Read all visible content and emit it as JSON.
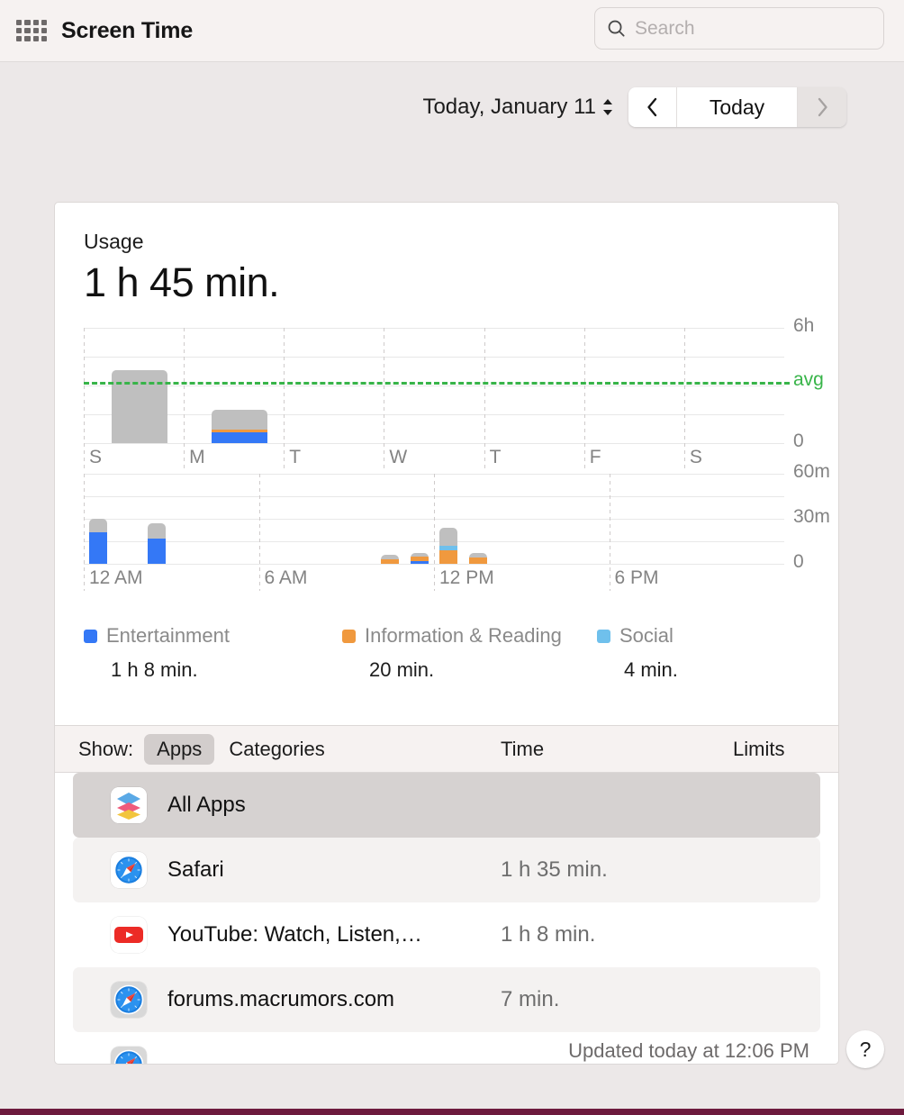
{
  "titlebar": {
    "grid_icon": "apps-grid-icon",
    "title": "Screen Time",
    "search_icon": "search-icon",
    "search_value": "",
    "search_placeholder": "Search"
  },
  "datebar": {
    "date_label": "Today, January 11",
    "stepper_icon": "up-down-stepper-icon",
    "prev_icon": "chevron-left-icon",
    "today_label": "Today",
    "next_icon": "chevron-right-icon"
  },
  "usage": {
    "label": "Usage",
    "total": "1 h 45 min."
  },
  "chart_data": [
    {
      "type": "bar",
      "name": "weekly-usage-chart",
      "title": "Usage",
      "orientation": "stacked-vertical",
      "categories": [
        "S",
        "M",
        "T",
        "W",
        "T",
        "F",
        "S"
      ],
      "xlabel": "",
      "ylabel": "",
      "ylim": [
        0,
        6
      ],
      "y_unit": "hours",
      "ticks": [
        "6h",
        "",
        "",
        "",
        "0"
      ],
      "tick_values": [
        6,
        4.5,
        3,
        1.5,
        0
      ],
      "grid": true,
      "annotations": [
        {
          "label": "avg",
          "value": 3.2,
          "color": "#38b449",
          "style": "dashed-line"
        }
      ],
      "series": [
        {
          "name": "Entertainment",
          "color": "#3478f6",
          "values": [
            0,
            0.58,
            0,
            0,
            0,
            0,
            0
          ]
        },
        {
          "name": "Information & Reading",
          "color": "#f0993e",
          "values": [
            0,
            0.14,
            0,
            0,
            0,
            0,
            0
          ]
        },
        {
          "name": "Social",
          "color": "#6fc0ec",
          "values": [
            0,
            0.0,
            0,
            0,
            0,
            0,
            0
          ]
        },
        {
          "name": "Other",
          "color": "#bfbfbf",
          "values": [
            3.8,
            1.03,
            0,
            0,
            0,
            0,
            0
          ]
        }
      ]
    },
    {
      "type": "bar",
      "name": "hourly-usage-chart",
      "orientation": "stacked-vertical",
      "categories": [
        "12 AM",
        "6 AM",
        "12 PM",
        "6 PM"
      ],
      "x": [
        "12 AM",
        "1 AM",
        "2 AM",
        "3 AM",
        "4 AM",
        "5 AM",
        "6 AM",
        "7 AM",
        "8 AM",
        "9 AM",
        "10 AM",
        "11 AM",
        "12 PM",
        "1 PM",
        "2 PM",
        "3 PM",
        "4 PM",
        "5 PM",
        "6 PM",
        "7 PM",
        "8 PM",
        "9 PM",
        "10 PM",
        "11 PM"
      ],
      "xlabel": "",
      "ylabel": "",
      "ylim": [
        0,
        60
      ],
      "y_unit": "minutes",
      "ticks": [
        "60m",
        "30m",
        "0"
      ],
      "tick_values": [
        60,
        30,
        0
      ],
      "grid": true,
      "series": [
        {
          "name": "Entertainment",
          "color": "#3478f6",
          "values": [
            21,
            0,
            17,
            0,
            0,
            0,
            0,
            0,
            0,
            0,
            0,
            2,
            0,
            0,
            0,
            0,
            0,
            0,
            0,
            0,
            0,
            0,
            0,
            0
          ]
        },
        {
          "name": "Information & Reading",
          "color": "#f0993e",
          "values": [
            0,
            0,
            0,
            0,
            0,
            0,
            0,
            0,
            0,
            0,
            3,
            3,
            9,
            4,
            0,
            0,
            0,
            0,
            0,
            0,
            0,
            0,
            0,
            0
          ]
        },
        {
          "name": "Social",
          "color": "#6fc0ec",
          "values": [
            0,
            0,
            0,
            0,
            0,
            0,
            0,
            0,
            0,
            0,
            0,
            0,
            3,
            0,
            0,
            0,
            0,
            0,
            0,
            0,
            0,
            0,
            0,
            0
          ]
        },
        {
          "name": "Other",
          "color": "#bfbfbf",
          "values": [
            9,
            0,
            10,
            0,
            0,
            0,
            0,
            0,
            0,
            0,
            3,
            2,
            12,
            3,
            0,
            0,
            0,
            0,
            0,
            0,
            0,
            0,
            0,
            0
          ]
        }
      ]
    }
  ],
  "legend": [
    {
      "name": "Entertainment",
      "color": "#3478f6",
      "time": "1 h 8 min."
    },
    {
      "name": "Information & Reading",
      "color": "#f0993e",
      "time": "20 min."
    },
    {
      "name": "Social",
      "color": "#6fc0ec",
      "time": "4 min."
    }
  ],
  "showbar": {
    "label": "Show:",
    "apps_tab": "Apps",
    "categories_tab": "Categories",
    "col_time": "Time",
    "col_limits": "Limits"
  },
  "apps": [
    {
      "name": "All Apps",
      "time": "",
      "icon": "all-apps-stack-icon"
    },
    {
      "name": "Safari",
      "time": "1 h 35 min.",
      "icon": "safari-compass-icon"
    },
    {
      "name": "YouTube: Watch, Listen,…",
      "time": "1 h 8 min.",
      "icon": "youtube-play-icon"
    },
    {
      "name": "forums.macrumors.com",
      "time": "7 min.",
      "icon": "safari-website-icon"
    },
    {
      "name": "",
      "time": "",
      "icon": "safari-website-icon"
    }
  ],
  "footer": {
    "updated": "Updated today at 12:06 PM",
    "help_label": "?"
  }
}
